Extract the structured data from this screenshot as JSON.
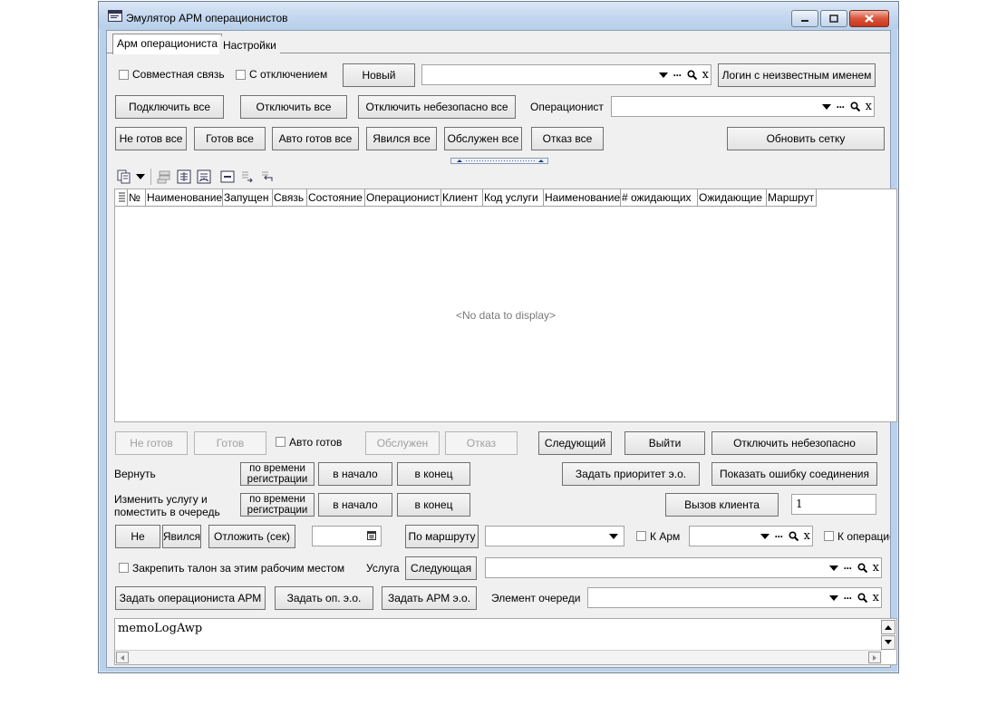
{
  "window": {
    "title": "Эмулятор АРМ операционистов"
  },
  "tabs": [
    {
      "label": "Арм операциониста",
      "active": true
    },
    {
      "label": "Настройки",
      "active": false
    }
  ],
  "top": {
    "joint_link_label": "Совместная связь",
    "with_disconnect_label": "С отключением",
    "new_button": "Новый",
    "login_unknown_button": "Логин с неизвестным именем",
    "connect_all": "Подключить все",
    "disconnect_all": "Отключить все",
    "disconnect_unsafe_all": "Отключить небезопасно все",
    "operator_label": "Операционист",
    "not_ready_all": "Не готов все",
    "ready_all": "Готов все",
    "auto_ready_all": "Авто готов все",
    "arrived_all": "Явился все",
    "served_all": "Обслужен все",
    "refuse_all": "Отказ все",
    "refresh_grid": "Обновить сетку"
  },
  "grid": {
    "columns": [
      "№",
      "Наименование",
      "Запущен",
      "Связь",
      "Состояние",
      "Операционист",
      "Клиент",
      "Код услуги",
      "Наименование",
      "# ожидающих",
      "Ожидающие",
      "Маршрут"
    ],
    "empty_text": "<No data to display>"
  },
  "actions": {
    "not_ready": "Не готов",
    "ready": "Готов",
    "auto_ready": "Авто готов",
    "served": "Обслужен",
    "refuse": "Отказ",
    "next": "Следующий",
    "exit": "Выйти",
    "disconnect_unsafe": "Отключить небезопасно",
    "return_label": "Вернуть",
    "by_reg_time": "по времени регистрации",
    "to_start": "в начало",
    "to_end": "в конец",
    "set_priority": "Задать приоритет э.о.",
    "show_conn_error": "Показать ошибку соединения",
    "change_service_label": "Изменить услугу и поместить в очередь",
    "call_client": "Вызов клиента",
    "call_client_value": "1",
    "no_show": "Не",
    "arrived": "Явился",
    "postpone": "Отложить (сек)",
    "by_route": "По маршруту",
    "to_arm_label": "К Арм",
    "to_operator_label": "К операцио",
    "pin_ticket_label": "Закрепить талон за этим рабочим местом",
    "service_label": "Услуга",
    "service_next": "Следующая",
    "set_operator_arm": "Задать операциониста АРМ",
    "set_op_eo": "Задать оп. э.о.",
    "set_arm_eo": "Задать АРМ э.о.",
    "queue_element_label": "Элемент очереди"
  },
  "memo": {
    "text": "memoLogAwp"
  },
  "icons": {
    "title": "app-window-icon",
    "search": "magnifier-icon",
    "calendar": "calendar-icon"
  }
}
